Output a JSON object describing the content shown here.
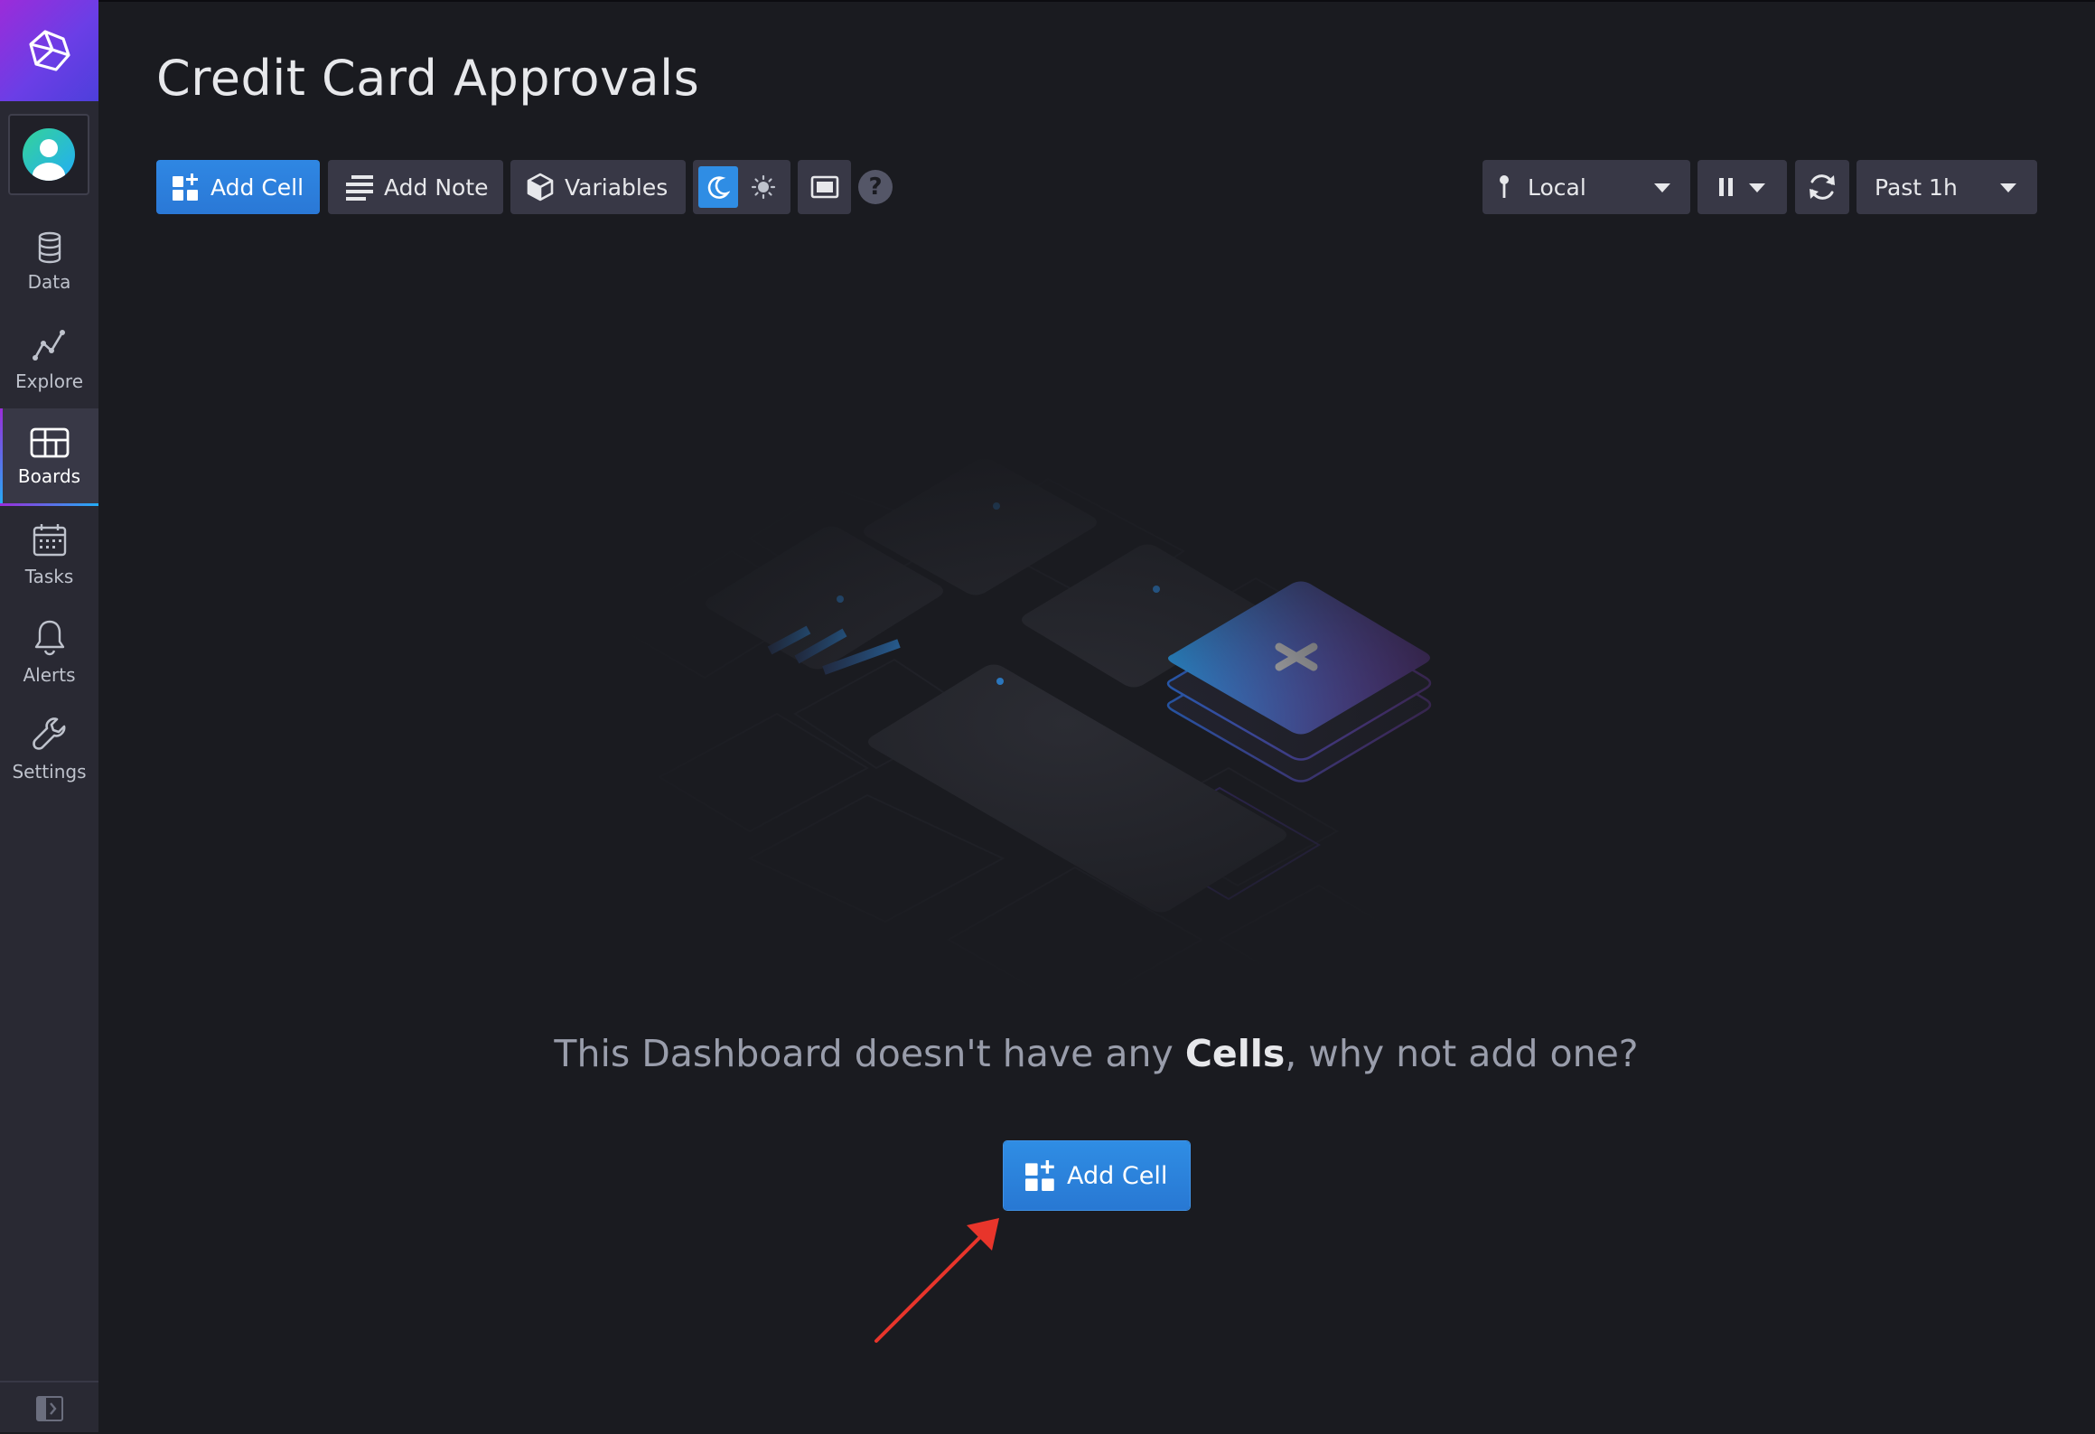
{
  "sidebar": {
    "items": [
      {
        "label": "Data",
        "icon": "database-icon"
      },
      {
        "label": "Explore",
        "icon": "graph-line-icon"
      },
      {
        "label": "Boards",
        "icon": "dashboard-grid-icon",
        "active": true
      },
      {
        "label": "Tasks",
        "icon": "calendar-icon"
      },
      {
        "label": "Alerts",
        "icon": "bell-icon"
      },
      {
        "label": "Settings",
        "icon": "wrench-icon"
      }
    ]
  },
  "header": {
    "title": "Credit Card Approvals",
    "add_cell_label": "Add Cell",
    "add_note_label": "Add Note",
    "variables_label": "Variables",
    "timezone_label": "Local",
    "time_range_label": "Past 1h"
  },
  "empty_state": {
    "message_before": "This Dashboard doesn't have any ",
    "message_bold": "Cells",
    "message_after": ", why not add one?",
    "cta_label": "Add Cell"
  },
  "colors": {
    "accent_blue": "#2f87e3",
    "brand_purple": "#9b2cd9",
    "annotation_arrow": "#e8352b"
  }
}
